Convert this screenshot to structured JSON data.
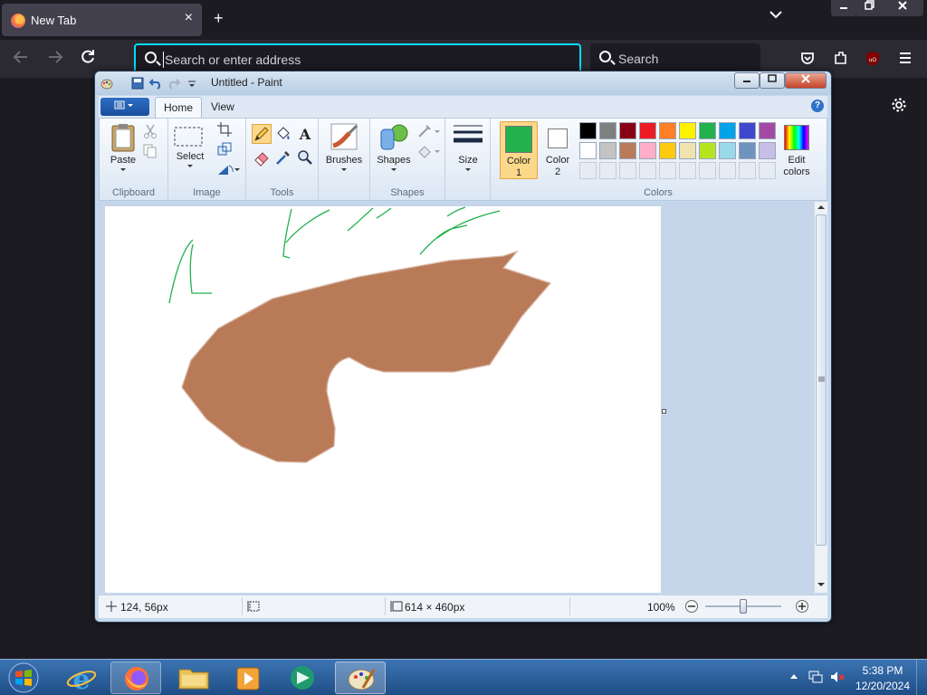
{
  "browser": {
    "tab": {
      "title": "New Tab",
      "close": "×"
    },
    "new_tab": "+",
    "list_tabs": "⌄",
    "urlbar": {
      "placeholder": "Search or enter address"
    },
    "searchbar": {
      "placeholder": "Search"
    },
    "window_controls": {
      "minimize": "▁",
      "maximize": "❐",
      "close": "✕"
    }
  },
  "paint": {
    "title": "Untitled - Paint",
    "tabs": {
      "home": "Home",
      "view": "View"
    },
    "help": "?",
    "groups": {
      "clipboard": {
        "label": "Clipboard",
        "paste": "Paste"
      },
      "image": {
        "label": "Image",
        "select": "Select"
      },
      "tools": {
        "label": "Tools"
      },
      "shapes_group": {
        "label": "Shapes",
        "brushes": "Brushes",
        "shapes": "Shapes"
      },
      "size": "Size",
      "colors": {
        "label": "Colors",
        "color1": "Color 1",
        "color1_line1": "Color",
        "color1_line2": "1",
        "color2_line1": "Color",
        "color2_line2": "2",
        "edit_line1": "Edit",
        "edit_line2": "colors"
      }
    },
    "color1_value": "#22b14c",
    "color2_value": "#ffffff",
    "palette_row1": [
      "#000000",
      "#7f7f7f",
      "#880015",
      "#ed1c24",
      "#ff7f27",
      "#fff200",
      "#22b14c",
      "#00a2e8",
      "#3f48cc",
      "#a349a4"
    ],
    "palette_row2": [
      "#ffffff",
      "#c3c3c3",
      "#b97a57",
      "#ffaec9",
      "#ffc90e",
      "#efe4b0",
      "#b5e61d",
      "#99d9ea",
      "#7092be",
      "#c8bfe7"
    ],
    "status": {
      "cursor": "124, 56px",
      "canvas_size": "614 × 460px",
      "zoom": "100%"
    }
  },
  "taskbar": {
    "time": "5:38 PM",
    "date": "12/20/2024"
  }
}
